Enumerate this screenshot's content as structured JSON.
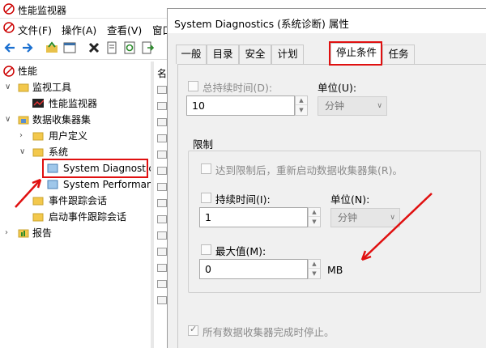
{
  "window": {
    "title": "性能监视器"
  },
  "menu": {
    "file": "文件(F)",
    "action": "操作(A)",
    "view": "查看(V)",
    "window": "窗口"
  },
  "tree": {
    "perf": "性能",
    "monitor_tools": "监视工具",
    "perf_monitor": "性能监视器",
    "dcs": "数据收集器集",
    "user_defined": "用户定义",
    "system": "系统",
    "sys_diag": "System Diagnostics",
    "sys_perf": "System Performance",
    "event_trace": "事件跟踪会话",
    "startup_trace": "启动事件跟踪会话",
    "reports": "报告"
  },
  "list": {
    "header": "名"
  },
  "dialog": {
    "title": "System Diagnostics (系统诊断) 属性",
    "tabs": [
      "一般",
      "目录",
      "安全",
      "计划",
      "停止条件",
      "任务"
    ],
    "overall_duration_label": "总持续时间(D):",
    "overall_duration_checked": false,
    "unit_label_1": "单位(U):",
    "overall_value": "10",
    "unit_value_1": "分钟",
    "limits_label": "限制",
    "restart_label": "达到限制后，重新启动数据收集器集(R)。",
    "restart_checked": false,
    "duration_label": "持续时间(I):",
    "duration_checked": false,
    "unit_label_2": "单位(N):",
    "duration_value": "1",
    "unit_value_2": "分钟",
    "max_size_label": "最大值(M):",
    "max_size_checked": false,
    "max_size_value": "0",
    "max_size_unit": "MB",
    "stop_all_label": "所有数据收集器完成时停止。",
    "stop_all_checked": true
  },
  "colors": {
    "highlight": "#e01010",
    "disabled_text": "#8a8a8a"
  }
}
